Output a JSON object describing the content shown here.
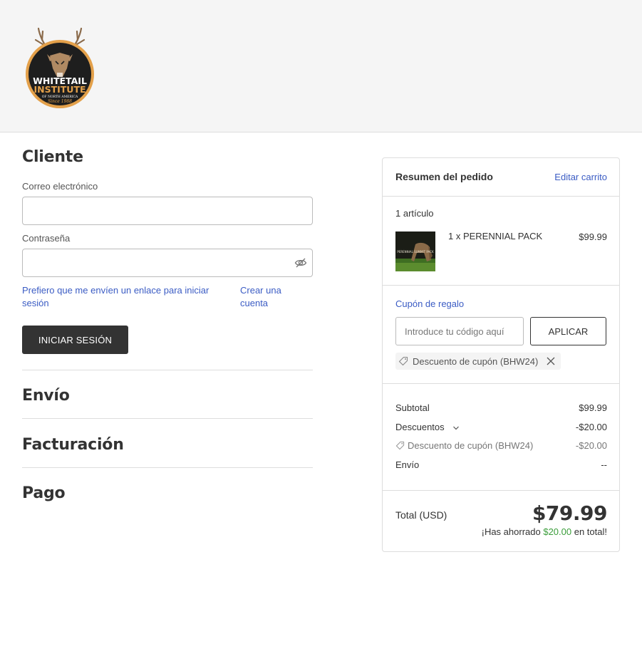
{
  "brand": {
    "logo_text_1": "WHITETAIL",
    "logo_text_2": "INSTITUTE",
    "logo_text_3": "OF NORTH AMERICA",
    "logo_text_4": "Since 1988"
  },
  "customer": {
    "title": "Cliente",
    "email_label": "Correo electrónico",
    "email_value": "",
    "password_label": "Contraseña",
    "password_value": "",
    "magic_link_text": "Prefiero que me envíen un enlace para iniciar sesión",
    "create_account_text": "Crear una cuenta",
    "login_button": "INICIAR SESIÓN"
  },
  "steps": {
    "shipping": "Envío",
    "billing": "Facturación",
    "payment": "Pago"
  },
  "summary": {
    "title": "Resumen del pedido",
    "edit_cart": "Editar carrito",
    "item_count": "1 artículo",
    "items": [
      {
        "name": "1 x PERENNIAL PACK",
        "price": "$99.99",
        "thumb_text": "PERENNIAL SUMMIT PACK"
      }
    ],
    "coupon_link": "Cupón de regalo",
    "coupon_placeholder": "Introduce tu código aquí",
    "apply_button": "APLICAR",
    "applied_coupon": "Descuento de cupón (BHW24)",
    "subtotal_label": "Subtotal",
    "subtotal_value": "$99.99",
    "discounts_label": "Descuentos",
    "discounts_value": "-$20.00",
    "coupon_discount_label": "Descuento de cupón (BHW24)",
    "coupon_discount_value": "-$20.00",
    "shipping_label": "Envío",
    "shipping_value": "--",
    "total_label": "Total (USD)",
    "total_value": "$79.99",
    "saved_prefix": "¡Has ahorrado",
    "saved_amount": "$20.00",
    "saved_suffix": "en total!"
  },
  "colors": {
    "link": "#3b5cc4",
    "button_dark": "#333333",
    "savings_green": "#3a9d3a",
    "header_bg": "#f5f5f5"
  },
  "icons": [
    "eye-off-icon",
    "tag-icon",
    "close-icon",
    "chevron-down-icon"
  ]
}
